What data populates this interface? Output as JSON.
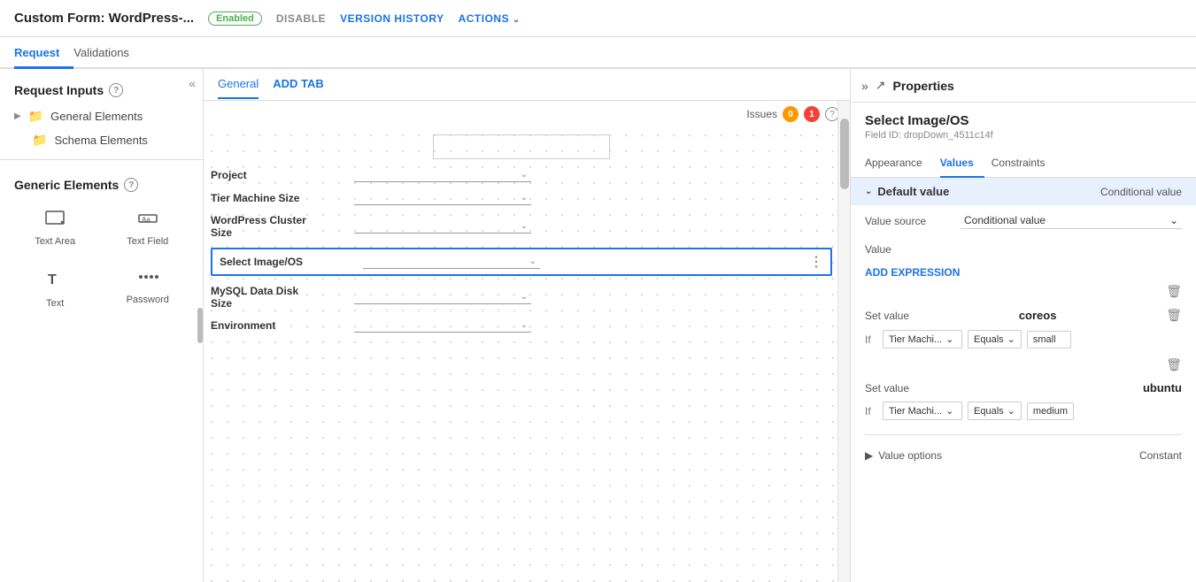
{
  "topbar": {
    "title": "Custom Form: WordPress-...",
    "badge": "Enabled",
    "actions": [
      {
        "id": "disable",
        "label": "DISABLE"
      },
      {
        "id": "version-history",
        "label": "VERSION HISTORY"
      },
      {
        "id": "actions",
        "label": "ACTIONS",
        "hasChevron": true
      }
    ]
  },
  "main_tabs": [
    {
      "id": "request",
      "label": "Request",
      "active": true
    },
    {
      "id": "validations",
      "label": "Validations",
      "active": false
    }
  ],
  "sidebar": {
    "title": "Request Inputs",
    "sections": [
      {
        "id": "general-elements",
        "label": "General Elements",
        "hasArrow": true,
        "hasFolder": true
      },
      {
        "id": "schema-elements",
        "label": "Schema Elements",
        "hasFolder": true
      }
    ]
  },
  "generic_elements": {
    "title": "Generic Elements",
    "items": [
      {
        "id": "text-area",
        "label": "Text Area",
        "icon": "textarea"
      },
      {
        "id": "text-field",
        "label": "Text Field",
        "icon": "textfield"
      },
      {
        "id": "text",
        "label": "Text",
        "icon": "text"
      },
      {
        "id": "password",
        "label": "Password",
        "icon": "password"
      }
    ]
  },
  "canvas": {
    "tabs": [
      {
        "id": "general",
        "label": "General",
        "active": true
      },
      {
        "id": "add-tab",
        "label": "ADD TAB",
        "isAdd": true
      }
    ],
    "issues_label": "Issues",
    "issues_orange": "0",
    "issues_red": "1",
    "fields": [
      {
        "id": "project",
        "label": "Project",
        "type": "dropdown"
      },
      {
        "id": "tier-machine-size",
        "label": "Tier Machine Size",
        "type": "dropdown"
      },
      {
        "id": "wordpress-cluster-size",
        "label": "WordPress Cluster Size",
        "type": "dropdown",
        "multiline": true
      },
      {
        "id": "select-image-os",
        "label": "Select Image/OS",
        "type": "dropdown",
        "selected": true
      },
      {
        "id": "mysql-data-disk-size",
        "label": "MySQL Data Disk Size",
        "type": "dropdown",
        "multiline": true
      },
      {
        "id": "environment",
        "label": "Environment",
        "type": "dropdown"
      }
    ]
  },
  "properties_panel": {
    "title": "Properties",
    "field_title": "Select Image/OS",
    "field_id": "Field ID: dropDown_4511c14f",
    "tabs": [
      {
        "id": "appearance",
        "label": "Appearance"
      },
      {
        "id": "values",
        "label": "Values",
        "active": true
      },
      {
        "id": "constraints",
        "label": "Constraints"
      }
    ],
    "values": {
      "default_value_label": "Default value",
      "conditional_value_label": "Conditional value",
      "value_source_label": "Value source",
      "value_source_value": "Conditional value",
      "value_label": "Value",
      "add_expression_label": "ADD EXPRESSION",
      "set_value_blocks": [
        {
          "set_value_label": "Set value",
          "set_value": "coreos",
          "condition_if": "If",
          "condition_field": "Tier Machi...",
          "condition_op": "Equals",
          "condition_value": "small"
        },
        {
          "set_value_label": "Set value",
          "set_value": "ubuntu",
          "condition_if": "If",
          "condition_field": "Tier Machi...",
          "condition_op": "Equals",
          "condition_value": "medium"
        }
      ],
      "value_options_label": "Value options",
      "value_options_value": "Constant"
    }
  }
}
